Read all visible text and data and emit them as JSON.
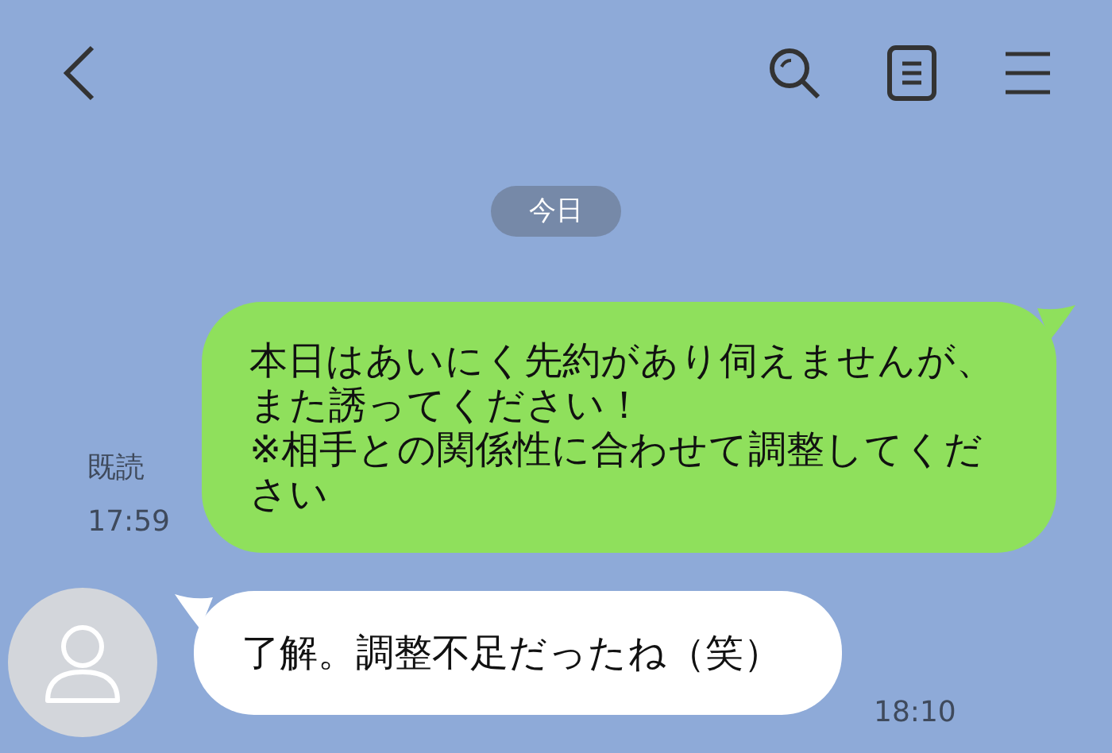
{
  "date_label": "今日",
  "messages": [
    {
      "kind": "sent",
      "lines": [
        "本日はあいにく先約があり伺えませんが、",
        "また誘ってください！",
        "※相手との関係性に合わせて調整してください"
      ],
      "read_label": "既読",
      "time": "17:59"
    },
    {
      "kind": "received",
      "lines": [
        "了解。調整不足だったね（笑）"
      ],
      "time": "18:10"
    }
  ]
}
